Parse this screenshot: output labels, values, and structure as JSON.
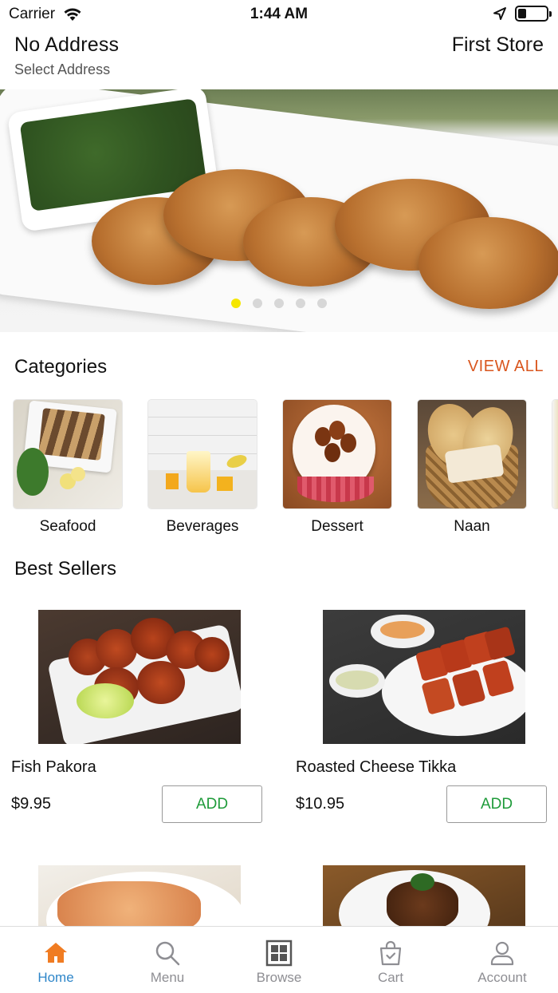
{
  "status_bar": {
    "carrier": "Carrier",
    "time": "1:44 AM"
  },
  "header": {
    "address_title": "No Address",
    "address_subtitle": "Select Address",
    "store_name": "First Store"
  },
  "banner": {
    "slide_count": 5,
    "active_slide": 1
  },
  "categories": {
    "title": "Categories",
    "view_all": "VIEW ALL",
    "items": [
      {
        "label": "Seafood"
      },
      {
        "label": "Beverages"
      },
      {
        "label": "Dessert"
      },
      {
        "label": "Naan"
      }
    ]
  },
  "best_sellers": {
    "title": "Best Sellers",
    "items": [
      {
        "name": "Fish Pakora",
        "price": "$9.95",
        "add_label": "ADD"
      },
      {
        "name": "Roasted Cheese Tikka",
        "price": "$10.95",
        "add_label": "ADD"
      }
    ]
  },
  "tab_bar": {
    "items": [
      {
        "label": "Home",
        "icon": "home-icon",
        "active": true
      },
      {
        "label": "Menu",
        "icon": "search-icon"
      },
      {
        "label": "Browse",
        "icon": "grid-icon"
      },
      {
        "label": "Cart",
        "icon": "bag-icon"
      },
      {
        "label": "Account",
        "icon": "person-icon"
      }
    ]
  },
  "colors": {
    "accent": "#d9561e",
    "add_text": "#1f9b3a",
    "tab_active": "#2e86c9",
    "active_dot": "#f5e600",
    "home_icon": "#f07c22"
  }
}
